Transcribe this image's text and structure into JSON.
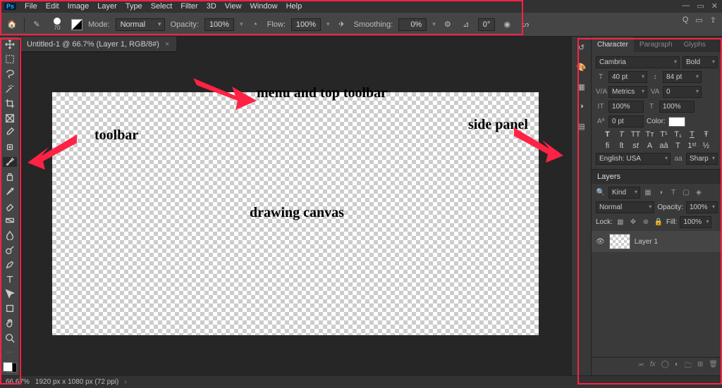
{
  "menu": [
    "File",
    "Edit",
    "Image",
    "Layer",
    "Type",
    "Select",
    "Filter",
    "3D",
    "View",
    "Window",
    "Help"
  ],
  "options": {
    "brush_size": "70",
    "mode_label": "Mode:",
    "mode_value": "Normal",
    "opacity_label": "Opacity:",
    "opacity_value": "100%",
    "flow_label": "Flow:",
    "flow_value": "100%",
    "smoothing_label": "Smoothing:",
    "smoothing_value": "0%",
    "angle_value": "0°"
  },
  "doc": {
    "tab_title": "Untitled-1 @ 66.7% (Layer 1, RGB/8#)"
  },
  "annotations": {
    "top": "menu and top toolbar",
    "left": "toolbar",
    "right": "side panel",
    "center": "drawing canvas"
  },
  "character": {
    "tab1": "Character",
    "tab2": "Paragraph",
    "tab3": "Glyphs",
    "font": "Cambria",
    "style": "Bold",
    "size": "40 pt",
    "leading": "84 pt",
    "kerning": "Metrics",
    "tracking": "0",
    "vscale": "100%",
    "hscale": "100%",
    "baseline": "0 pt",
    "color_label": "Color:",
    "lang": "English: USA",
    "aa_prefix": "aa",
    "aa": "Sharp"
  },
  "layers": {
    "title": "Layers",
    "kind_label": "Kind",
    "blend": "Normal",
    "opacity_label": "Opacity:",
    "opacity": "100%",
    "lock_label": "Lock:",
    "fill_label": "Fill:",
    "fill": "100%",
    "layer1": "Layer 1"
  },
  "status": {
    "zoom": "66.67%",
    "dims": "1920 px x 1080 px (72 ppi)"
  },
  "search_icon": "Q"
}
